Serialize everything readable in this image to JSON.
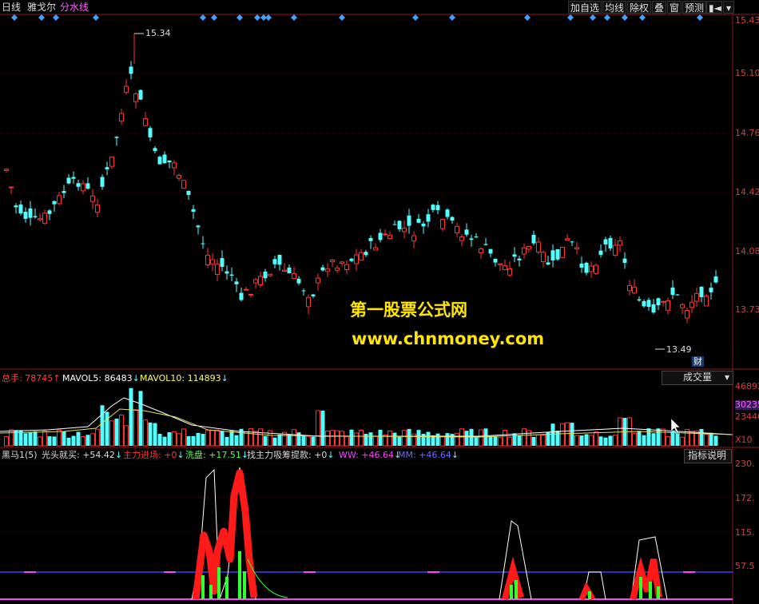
{
  "topbar": {
    "period": "日线",
    "indicator_a": "雅戈尔",
    "indicator_b": "分水线",
    "buttons": [
      "加自选",
      "均线",
      "除权",
      "叠",
      "窗",
      "预测"
    ],
    "pin_icon": "pin-icon",
    "dropdown_icon": "chevron-down-icon"
  },
  "price_panel": {
    "high_label": "15.34",
    "low_label": "13.49",
    "cai_badge": "财",
    "axis": [
      "15.43",
      "15.10",
      "14.76",
      "14.42",
      "14.08",
      "13.73"
    ]
  },
  "watermark": {
    "line1": "第一股票公式网",
    "line2": "www.chnmoney.com"
  },
  "volume_panel": {
    "total_label": "总手: 78745",
    "ma5_label": "MAVOL5: 86483",
    "ma10_label": "MAVOL10: 114893",
    "type_select": "成交量",
    "axis": [
      "46892",
      "30235",
      "23446",
      "X10"
    ]
  },
  "indicator_panel": {
    "name": "黑马1(5)",
    "v1": "光头就买: +54.42",
    "v2": "主力进场: +0",
    "v3": "洗盘: +17.51",
    "v4": "找主力吸筹提款: +0",
    "v5": "WW: +46.64",
    "v6": "MM: +46.64",
    "help_button": "指标说明",
    "axis": [
      "230.",
      "172.",
      "115.",
      "57.5"
    ]
  },
  "colors": {
    "up": "#ff3232",
    "down": "#54ffff",
    "axis": "#d04040",
    "ma5": "#ffffff",
    "ma10": "#ffff00"
  }
}
